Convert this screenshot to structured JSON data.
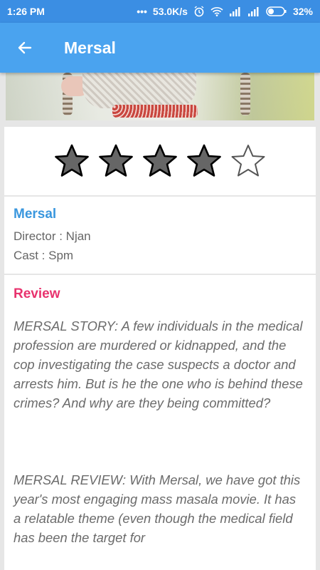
{
  "status_bar": {
    "time": "1:26 PM",
    "network_speed": "53.0K/s",
    "battery": "32%",
    "icons": [
      "more-dots-icon",
      "alarm-icon",
      "wifi-icon",
      "signal-icon",
      "signal-icon",
      "battery-icon"
    ]
  },
  "app_bar": {
    "title": "Mersal",
    "back_icon": "arrow-back-icon"
  },
  "rating": {
    "value": 4,
    "max": 5
  },
  "movie": {
    "name": "Mersal",
    "director": "Director : Njan",
    "cast": "Cast : Spm"
  },
  "review": {
    "heading": "Review",
    "paragraphs": [
      "MERSAL STORY: A few individuals in the medical profession are murdered or kidnapped, and the cop investigating the case suspects a doctor and arrests him. But is he the one who is behind these crimes? And why are they being committed?",
      "MERSAL REVIEW: With Mersal, we have got this year's most engaging mass masala movie. It has a relatable theme (even though the medical field has been the target for"
    ]
  },
  "colors": {
    "status_bar": "#3b8ee3",
    "app_bar": "#4aa3ef",
    "movie_name": "#3a97de",
    "review_heading": "#e8336e",
    "star_filled": "#666666"
  }
}
